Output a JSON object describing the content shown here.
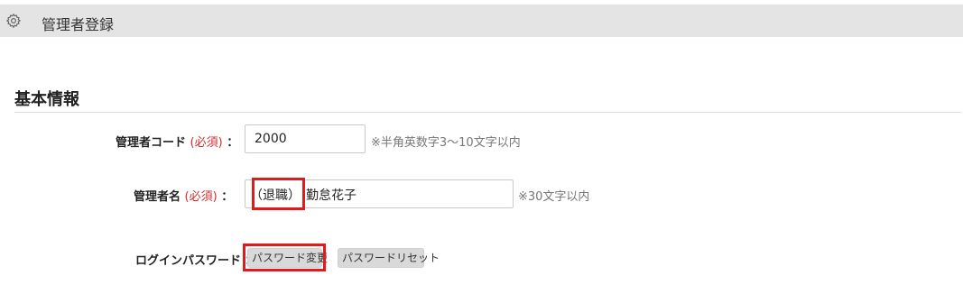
{
  "header": {
    "title": "管理者登録"
  },
  "section": {
    "title": "基本情報"
  },
  "fields": {
    "code": {
      "label": "管理者コード",
      "required": "(必須)",
      "colon": "：",
      "value": "2000",
      "hint": "※半角英数字3～10文字以内"
    },
    "name": {
      "label": "管理者名",
      "required": "(必須)",
      "colon": "：",
      "prefix": "（退職）",
      "value": "勤怠花子",
      "hint": "※30文字以内"
    },
    "password": {
      "label": "ログインパスワード",
      "colon": "：",
      "change_button": "パスワード変更",
      "reset_button": "パスワードリセット"
    }
  },
  "colors": {
    "header_bg": "#e4e4e4",
    "required": "#d32f2f",
    "highlight": "#e01b1b",
    "button_bg": "#d9d9d9"
  },
  "icons": {
    "header": "gear-icon"
  }
}
